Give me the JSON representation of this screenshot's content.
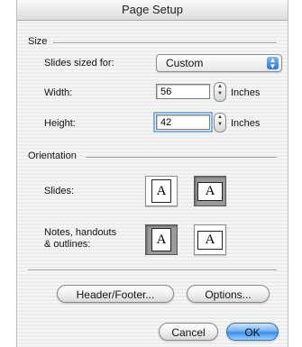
{
  "window": {
    "title": "Page Setup"
  },
  "size": {
    "group_label": "Size",
    "slides_sized_for_label": "Slides sized for:",
    "slides_sized_for_value": "Custom",
    "width_label": "Width:",
    "width_value": "56",
    "width_unit": "Inches",
    "height_label": "Height:",
    "height_value": "42",
    "height_unit": "Inches"
  },
  "orientation": {
    "group_label": "Orientation",
    "slides_label": "Slides:",
    "notes_label_line1": "Notes, handouts",
    "notes_label_line2": "& outlines:",
    "glyph": "A"
  },
  "buttons": {
    "header_footer": "Header/Footer...",
    "options": "Options...",
    "cancel": "Cancel",
    "ok": "OK"
  }
}
